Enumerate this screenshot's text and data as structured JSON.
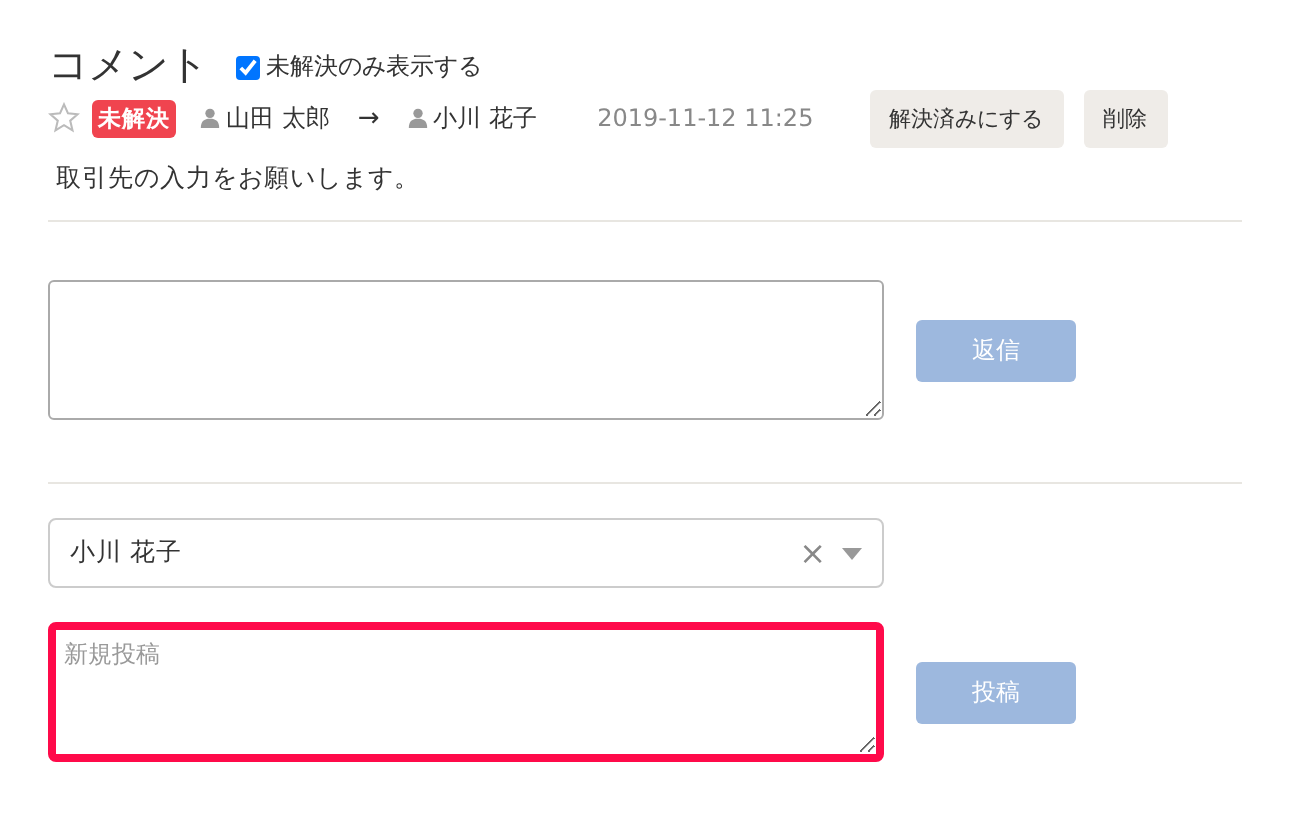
{
  "header": {
    "title": "コメント",
    "filter": {
      "label": "未解決のみ表示する",
      "checked": true
    }
  },
  "comment": {
    "starred": false,
    "status": "未解決",
    "author": "山田 太郎",
    "arrow": "→",
    "recipient": "小川 花子",
    "time": "2019-11-12 11:25",
    "buttons": [
      "解決済みにする",
      "削除"
    ],
    "body": "取引先の入力をお願いします。"
  },
  "reply": {
    "button": "返信",
    "button_disabled": true
  },
  "new_post": {
    "assignee": "小川 花子",
    "clear": "×",
    "placeholder": "新規投稿",
    "highlighted": true,
    "button": "投稿",
    "button_disabled": true
  }
}
